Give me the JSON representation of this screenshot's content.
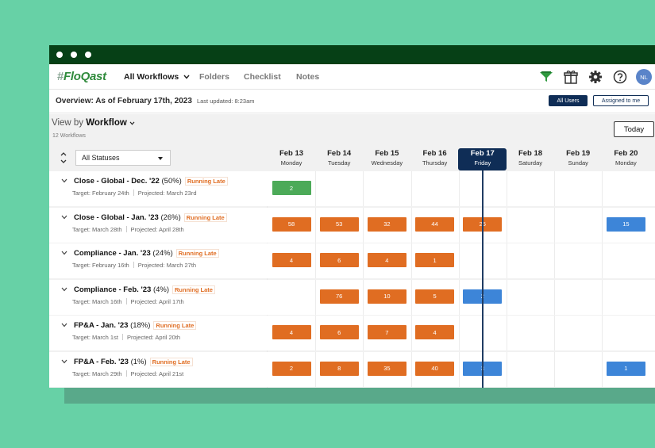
{
  "nav": {
    "logo_hash": "#",
    "logo_text": "FloQast",
    "workflows": "All Workflows",
    "folders": "Folders",
    "checklist": "Checklist",
    "notes": "Notes",
    "avatar": "NL"
  },
  "overview": {
    "title": "Overview: As of February 17th, 2023",
    "updated": "Last updated: 8:23am",
    "all_users": "All Users",
    "assigned_to_me": "Assigned to me"
  },
  "toolbar": {
    "view_by": "View by",
    "view_mode": "Workflow",
    "count": "12 Workflows",
    "today": "Today",
    "status_filter": "All Statuses"
  },
  "days": [
    {
      "date": "Feb 13",
      "weekday": "Monday"
    },
    {
      "date": "Feb 14",
      "weekday": "Tuesday"
    },
    {
      "date": "Feb 15",
      "weekday": "Wednesday"
    },
    {
      "date": "Feb 16",
      "weekday": "Thursday"
    },
    {
      "date": "Feb 17",
      "weekday": "Friday",
      "current": true
    },
    {
      "date": "Feb 18",
      "weekday": "Saturday"
    },
    {
      "date": "Feb 19",
      "weekday": "Sunday"
    },
    {
      "date": "Feb 20",
      "weekday": "Monday"
    }
  ],
  "rows": [
    {
      "name": "Close - Global - Dec. '22",
      "pct": "(50%)",
      "status": "Running Late",
      "target": "Target: February 24th",
      "projected": "Projected: March 23rd",
      "cells": [
        {
          "day": 0,
          "value": "2",
          "color": "green"
        }
      ]
    },
    {
      "name": "Close - Global - Jan. '23",
      "pct": "(26%)",
      "status": "Running Late",
      "target": "Target: March 28th",
      "projected": "Projected: April 28th",
      "cells": [
        {
          "day": 0,
          "value": "58",
          "color": "orange"
        },
        {
          "day": 1,
          "value": "53",
          "color": "orange"
        },
        {
          "day": 2,
          "value": "32",
          "color": "orange"
        },
        {
          "day": 3,
          "value": "44",
          "color": "orange"
        },
        {
          "day": 4,
          "value": "25",
          "color": "orange"
        },
        {
          "day": 7,
          "value": "15",
          "color": "blue"
        }
      ]
    },
    {
      "name": "Compliance - Jan. '23",
      "pct": "(24%)",
      "status": "Running Late",
      "target": "Target: February 16th",
      "projected": "Projected: March 27th",
      "cells": [
        {
          "day": 0,
          "value": "4",
          "color": "orange"
        },
        {
          "day": 1,
          "value": "6",
          "color": "orange"
        },
        {
          "day": 2,
          "value": "4",
          "color": "orange"
        },
        {
          "day": 3,
          "value": "1",
          "color": "orange"
        }
      ]
    },
    {
      "name": "Compliance - Feb. '23",
      "pct": "(4%)",
      "status": "Running Late",
      "target": "Target: March 16th",
      "projected": "Projected: April 17th",
      "cells": [
        {
          "day": 1,
          "value": "76",
          "color": "orange"
        },
        {
          "day": 2,
          "value": "10",
          "color": "orange"
        },
        {
          "day": 3,
          "value": "5",
          "color": "orange"
        },
        {
          "day": 4,
          "value": "2",
          "color": "blue"
        }
      ]
    },
    {
      "name": "FP&A - Jan. '23",
      "pct": "(18%)",
      "status": "Running Late",
      "target": "Target: March 1st",
      "projected": "Projected: April 20th",
      "cells": [
        {
          "day": 0,
          "value": "4",
          "color": "orange"
        },
        {
          "day": 1,
          "value": "6",
          "color": "orange"
        },
        {
          "day": 2,
          "value": "7",
          "color": "orange"
        },
        {
          "day": 3,
          "value": "4",
          "color": "orange"
        }
      ]
    },
    {
      "name": "FP&A - Feb. '23",
      "pct": "(1%)",
      "status": "Running Late",
      "target": "Target: March 29th",
      "projected": "Projected: April 21st",
      "cells": [
        {
          "day": 0,
          "value": "2",
          "color": "orange"
        },
        {
          "day": 1,
          "value": "8",
          "color": "orange"
        },
        {
          "day": 2,
          "value": "35",
          "color": "orange"
        },
        {
          "day": 3,
          "value": "40",
          "color": "orange"
        },
        {
          "day": 4,
          "value": "3",
          "color": "blue"
        },
        {
          "day": 7,
          "value": "1",
          "color": "blue"
        }
      ]
    }
  ]
}
